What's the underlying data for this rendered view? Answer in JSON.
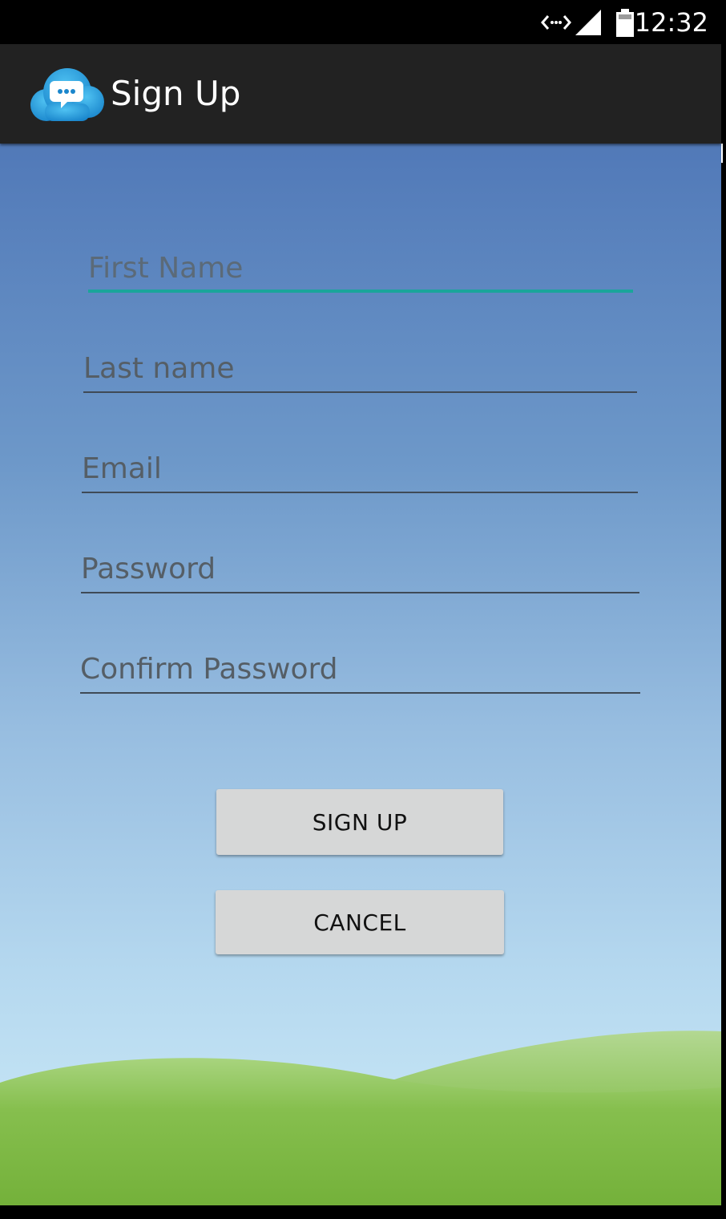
{
  "status_bar": {
    "time": "12:32",
    "icons": [
      "data-sync-icon",
      "cell-signal-icon",
      "battery-icon"
    ]
  },
  "app_bar": {
    "title": "Sign Up",
    "logo_icon": "cloud-chat-icon"
  },
  "form": {
    "first_name": {
      "placeholder": "First Name",
      "value": ""
    },
    "last_name": {
      "placeholder": "Last name",
      "value": ""
    },
    "email": {
      "placeholder": "Email",
      "value": ""
    },
    "password": {
      "placeholder": "Password",
      "value": ""
    },
    "confirm_password": {
      "placeholder": "Confirm Password",
      "value": ""
    }
  },
  "buttons": {
    "sign_up": "SIGN UP",
    "cancel": "CANCEL"
  },
  "colors": {
    "focus_accent": "#1aa59a",
    "app_bar": "#222222",
    "button_bg": "#d6d7d7",
    "sky_top": "#5179b8",
    "sky_bottom": "#c8e8f6",
    "grass": "#7ab540"
  }
}
